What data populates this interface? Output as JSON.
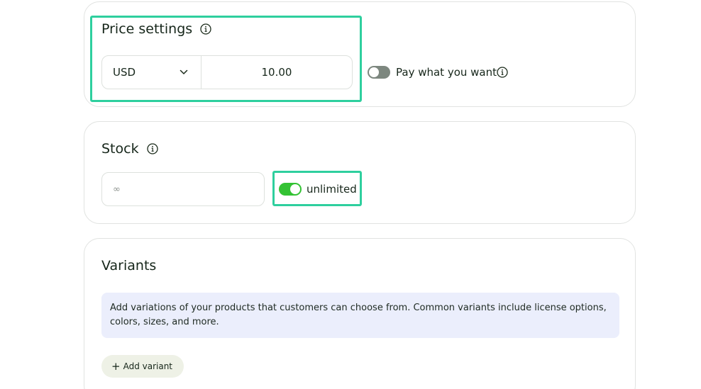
{
  "price": {
    "title": "Price settings",
    "currency": "USD",
    "amount": "10.00",
    "pwyw_label": "Pay what you want",
    "pwyw_enabled": false
  },
  "stock": {
    "title": "Stock",
    "placeholder": "∞",
    "unlimited_label": "unlimited",
    "unlimited_enabled": true
  },
  "variants": {
    "title": "Variants",
    "note": "Add variations of your products that customers can choose from. Common variants include license options, colors, sizes, and more.",
    "add_button_icon": "+",
    "add_button_label": "Add variant"
  },
  "colors": {
    "highlight": "#2ecf9e",
    "toggle_on": "#33c233",
    "toggle_off": "#7d877f",
    "note_bg": "#ebeefc",
    "button_bg": "#eef1e6"
  }
}
